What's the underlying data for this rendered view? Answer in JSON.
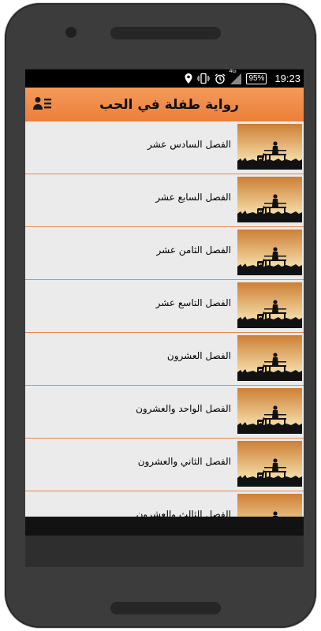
{
  "status": {
    "time": "19:23",
    "battery": "95%",
    "network": "4G",
    "icons": [
      "location-icon",
      "vibrate-icon",
      "alarm-icon",
      "signal-icon",
      "battery-icon"
    ]
  },
  "appbar": {
    "title": "رواية طفلة في الحب",
    "menu_icon": "person-list-icon"
  },
  "chapters": [
    {
      "label": "الفصل السادس عشر"
    },
    {
      "label": "الفصل السابع عشر"
    },
    {
      "label": "الفصل الثامن عشر"
    },
    {
      "label": "الفصل التاسع عشر"
    },
    {
      "label": "الفصل العشرون"
    },
    {
      "label": "الفصل الواحد والعشرون"
    },
    {
      "label": "الفصل الثاني والعشرون"
    },
    {
      "label": "الفصل الثالث والعشرون"
    }
  ],
  "colors": {
    "accent": "#ec7f3a",
    "divider": "#e8894b",
    "sunset_top": "#cd7f35",
    "sunset_bottom": "#f2d6a0"
  }
}
